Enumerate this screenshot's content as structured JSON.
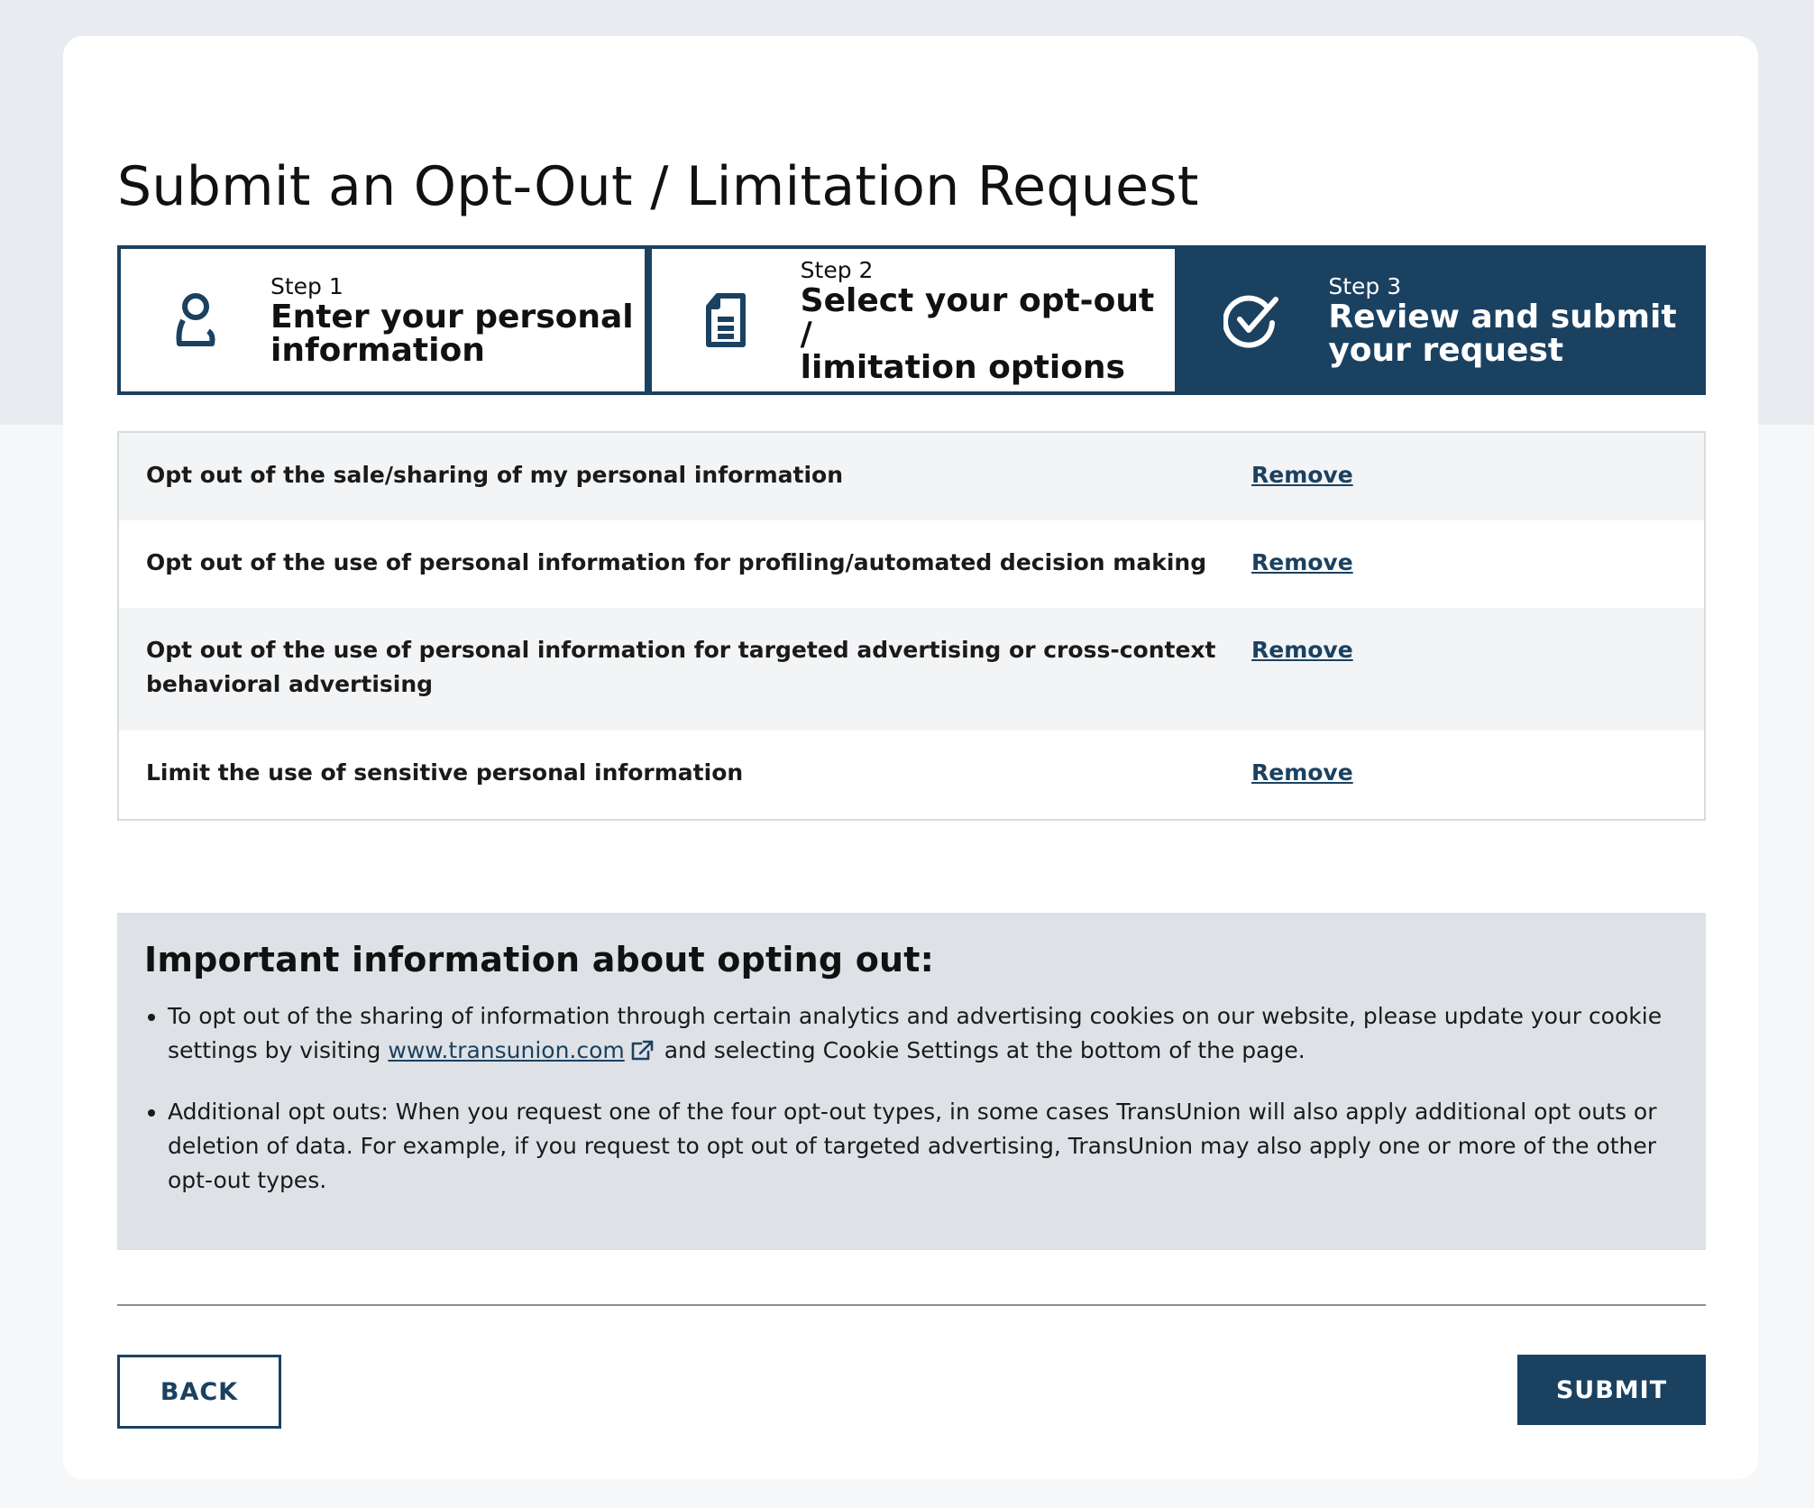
{
  "page_title": "Submit an Opt-Out / Limitation Request",
  "steps": [
    {
      "number": "Step 1",
      "title_line1": "Enter your personal",
      "title_line2": "information",
      "icon": "person-icon",
      "active": false
    },
    {
      "number": "Step 2",
      "title_line1": "Select your opt-out /",
      "title_line2": "limitation options",
      "icon": "document-icon",
      "active": false
    },
    {
      "number": "Step 3",
      "title_line1": "Review and submit",
      "title_line2": "your request",
      "icon": "check-circle-icon",
      "active": true
    }
  ],
  "options": [
    {
      "text": "Opt out of the sale/sharing of my personal information",
      "action": "Remove"
    },
    {
      "text": "Opt out of the use of personal information for profiling/automated decision making",
      "action": "Remove"
    },
    {
      "text": "Opt out of the use of personal information for targeted advertising or cross-context behavioral advertising",
      "action": "Remove"
    },
    {
      "text": "Limit the use of sensitive personal information",
      "action": "Remove"
    }
  ],
  "info": {
    "heading": "Important information about opting out:",
    "bullet1_before": "To opt out of the sharing of information through certain analytics and advertising cookies on our website, please update your cookie settings by visiting ",
    "bullet1_link": "www.transunion.com",
    "bullet1_after": " and selecting Cookie Settings at the bottom of the page.",
    "bullet2": "Additional opt outs: When you request one of the four opt-out types, in some cases TransUnion will also apply additional opt outs or deletion of data. For example, if you request to opt out of targeted advertising, TransUnion may also apply one or more of the other opt-out types."
  },
  "buttons": {
    "back": "BACK",
    "submit": "SUBMIT"
  },
  "colors": {
    "brand": "#1b4161",
    "page_bg_top": "#e8ecf0",
    "info_bg": "#dee2e6"
  }
}
